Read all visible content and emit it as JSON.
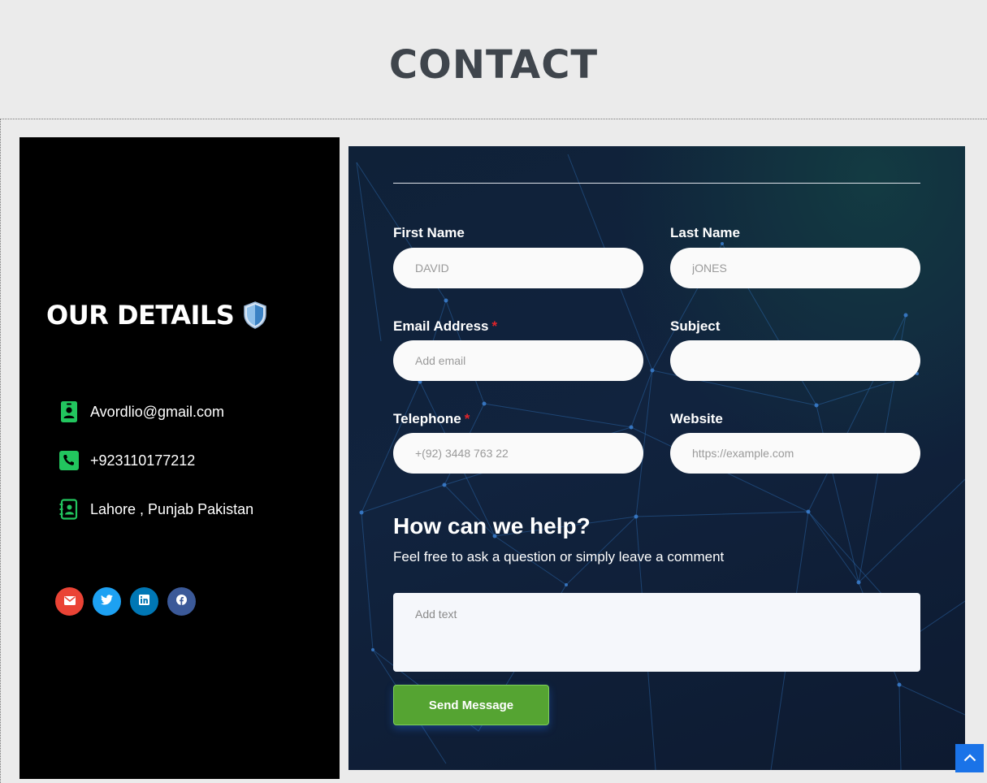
{
  "page": {
    "title": "CONTACT"
  },
  "details": {
    "title": "OUR DETAILS",
    "shield_icon": "shield-icon",
    "email": "Avordlio@gmail.com",
    "phone": "+923110177212",
    "address": "Lahore , Punjab Pakistan",
    "icon_color": "#22c55e",
    "socials": [
      {
        "name": "email",
        "icon": "envelope-icon",
        "color": "#ea4335"
      },
      {
        "name": "twitter",
        "icon": "twitter-icon",
        "color": "#1da1f2"
      },
      {
        "name": "linkedin",
        "icon": "linkedin-icon",
        "color": "#0077b5"
      },
      {
        "name": "facebook",
        "icon": "facebook-icon",
        "color": "#3b5998"
      }
    ]
  },
  "form": {
    "first_name": {
      "label": "First Name",
      "placeholder": "DAVID"
    },
    "last_name": {
      "label": "Last Name",
      "placeholder": "jONES"
    },
    "email": {
      "label": "Email Address",
      "required": "*",
      "placeholder": "Add email"
    },
    "subject": {
      "label": "Subject",
      "placeholder": ""
    },
    "telephone": {
      "label": "Telephone",
      "required": "*",
      "placeholder": "+(92) 3448 763 22"
    },
    "website": {
      "label": "Website",
      "placeholder": "https://example.com"
    },
    "help_title": "How can we help?",
    "help_subtitle": "Feel free to ask a question or simply leave a comment",
    "message_placeholder": "Add text",
    "submit_label": "Send Message"
  },
  "colors": {
    "submit": "#55a432",
    "required_marker": "#e0242b",
    "scroll_top": "#1a73e8"
  },
  "scroll_top_icon": "chevron-up-icon"
}
